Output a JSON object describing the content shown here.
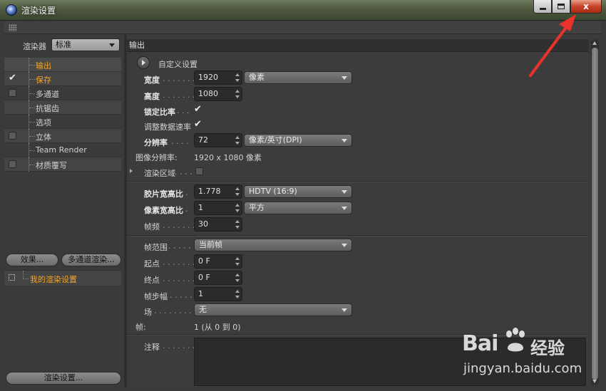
{
  "window": {
    "title": "渲染设置",
    "buttons": {
      "minimize": "minimize",
      "maximize": "maximize",
      "close": "x"
    }
  },
  "left": {
    "renderer_label": "渲染器",
    "renderer_value": "标准",
    "items": [
      {
        "label": "输出",
        "checked": null,
        "active": true
      },
      {
        "label": "保存",
        "checked": true,
        "active": false
      },
      {
        "label": "多通道",
        "checked": false,
        "active": false
      },
      {
        "label": "抗锯齿",
        "checked": null,
        "active": false
      },
      {
        "label": "选项",
        "checked": null,
        "active": false
      },
      {
        "label": "立体",
        "checked": false,
        "active": false
      },
      {
        "label": "Team Render",
        "checked": null,
        "active": false
      },
      {
        "label": "材质覆写",
        "checked": false,
        "active": false
      }
    ],
    "effects_button": "效果...",
    "multipass_button": "多通道渲染...",
    "my_setting": "我的渲染设置",
    "render_settings_button": "渲染设置..."
  },
  "output": {
    "section_title": "输出",
    "preset_label": "自定义设置",
    "width_label": "宽度",
    "width_value": "1920",
    "width_unit": "像素",
    "height_label": "高度",
    "height_value": "1080",
    "lock_ratio_label": "锁定比率",
    "adjust_rate_label": "调整数据速率",
    "resolution_label": "分辨率",
    "resolution_value": "72",
    "resolution_unit": "像素/英寸(DPI)",
    "image_res_label": "图像分辨率:",
    "image_res_value": "1920 x 1080 像素",
    "render_region_label": "渲染区域",
    "film_aspect_label": "胶片宽高比",
    "film_aspect_value": "1.778",
    "film_aspect_preset": "HDTV (16:9)",
    "pixel_aspect_label": "像素宽高比",
    "pixel_aspect_value": "1",
    "pixel_aspect_preset": "平方",
    "fps_label": "帧频",
    "fps_value": "30",
    "frame_range_label": "帧范围",
    "frame_range_value": "当前帧",
    "start_label": "起点",
    "start_value": "0 F",
    "end_label": "终点",
    "end_value": "0 F",
    "frame_step_label": "帧步幅",
    "frame_step_value": "1",
    "field_label": "场",
    "field_value": "无",
    "frames_label": "帧:",
    "frames_value": "1 (从 0 到 0)",
    "notes_label": "注释"
  },
  "watermark": {
    "brand": "Bai",
    "brand_cn": "经验",
    "url": "jingyan.baidu.com"
  },
  "colors": {
    "accent_orange": "#f2a427",
    "annotation_red": "#e8322a",
    "panel_bg": "#3c3c3c"
  }
}
